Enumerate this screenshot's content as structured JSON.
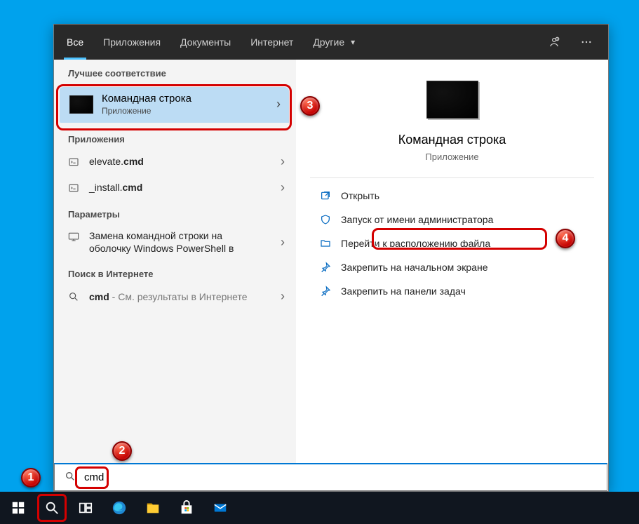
{
  "tabs": {
    "all": "Все",
    "apps": "Приложения",
    "docs": "Документы",
    "web": "Интернет",
    "more": "Другие"
  },
  "sections": {
    "best_match": "Лучшее соответствие",
    "apps": "Приложения",
    "settings": "Параметры",
    "web": "Поиск в Интернете"
  },
  "best": {
    "title": "Командная строка",
    "subtitle": "Приложение"
  },
  "apps_list": {
    "item1_prefix": "elevate.",
    "item1_bold": "cmd",
    "item2_prefix": "_install.",
    "item2_bold": "cmd"
  },
  "settings_item": {
    "text": "Замена командной строки на оболочку Windows PowerShell в"
  },
  "web_item": {
    "bold": "cmd",
    "suffix": " - См. результаты в Интернете"
  },
  "preview": {
    "title": "Командная строка",
    "subtitle": "Приложение"
  },
  "actions": {
    "open": "Открыть",
    "admin": "Запуск от имени администратора",
    "location": "Перейти к расположению файла",
    "pin_start": "Закрепить на начальном экране",
    "pin_taskbar": "Закрепить на панели задач"
  },
  "search_value": "cmd",
  "badges": {
    "b1": "1",
    "b2": "2",
    "b3": "3",
    "b4": "4"
  }
}
